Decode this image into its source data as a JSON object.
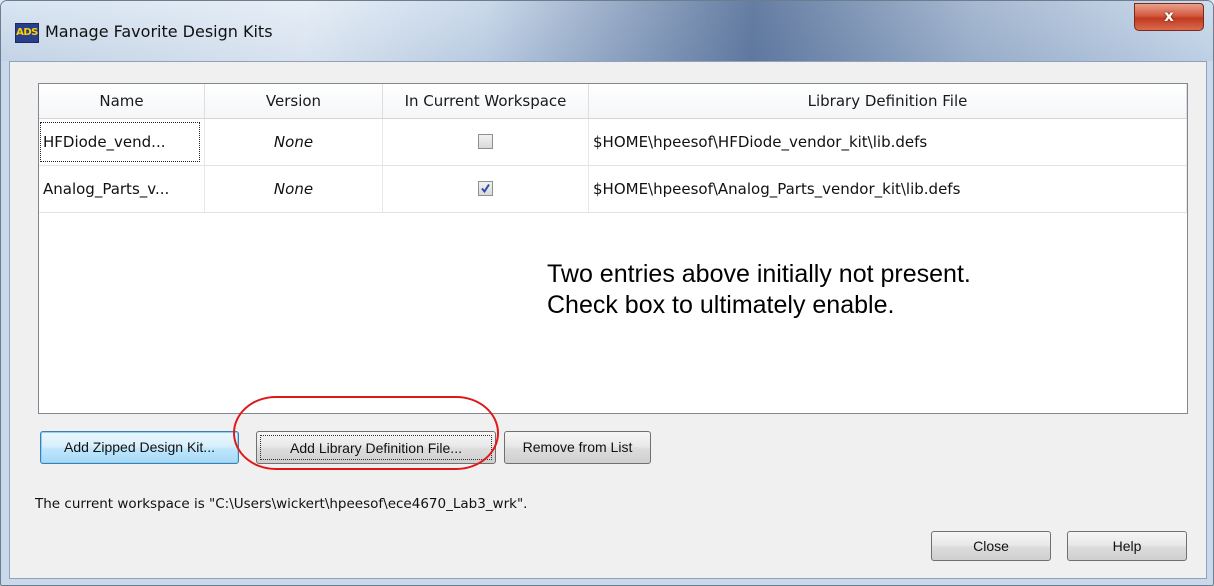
{
  "window": {
    "title": "Manage Favorite Design Kits",
    "icon_text": "ADS",
    "close_symbol": "x"
  },
  "table": {
    "columns": [
      "Name",
      "Version",
      "In Current Workspace",
      "Library Definition File"
    ],
    "rows": [
      {
        "name": "HFDiode_vend...",
        "version": "None",
        "in_workspace": false,
        "file": "$HOME\\hpeesof\\HFDiode_vendor_kit\\lib.defs"
      },
      {
        "name": "Analog_Parts_v...",
        "version": "None",
        "in_workspace": true,
        "file": "$HOME\\hpeesof\\Analog_Parts_vendor_kit\\lib.defs"
      }
    ]
  },
  "annotation": {
    "line1": "Two entries above initially not present.",
    "line2": "Check box to ultimately enable."
  },
  "buttons": {
    "add_zipped": "Add Zipped Design Kit...",
    "add_libdef": "Add Library Definition File...",
    "remove": "Remove from List",
    "close": "Close",
    "help": "Help"
  },
  "status": "The current workspace is \"C:\\Users\\wickert\\hpeesof\\ece4670_Lab3_wrk\".",
  "colors": {
    "highlight_oval": "#e01818",
    "checkmark": "#2b4ea8",
    "close_button": "#c03a20"
  },
  "icons": {
    "app": "ads-app-icon",
    "close": "close-icon",
    "checked": "checkmark-icon"
  }
}
